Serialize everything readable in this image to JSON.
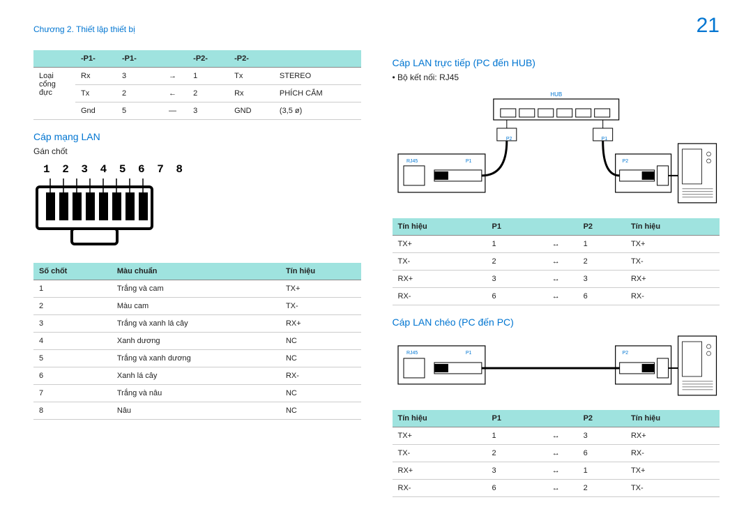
{
  "header": {
    "chapter": "Chương 2. Thiết lập thiết bị",
    "pagenum": "21"
  },
  "pinTable": {
    "headers": [
      "-P1-",
      "-P1-",
      "",
      "-P2-",
      "-P2-",
      ""
    ],
    "rowLabel": "Loại cổng đực",
    "rows": [
      [
        "Rx",
        "3",
        "→",
        "1",
        "Tx",
        "STEREO"
      ],
      [
        "Tx",
        "2",
        "←",
        "2",
        "Rx",
        "PHÍCH CẮM"
      ],
      [
        "Gnd",
        "5",
        "—",
        "3",
        "GND",
        "(3,5 ø)"
      ]
    ]
  },
  "lan": {
    "title": "Cáp mạng LAN",
    "sub": "Gán chốt",
    "pinNumbers": "1 2 3 4 5 6 7 8"
  },
  "colorTable": {
    "headers": [
      "Số chốt",
      "Màu chuẩn",
      "Tín hiệu"
    ],
    "rows": [
      [
        "1",
        "Trắng và cam",
        "TX+"
      ],
      [
        "2",
        "Màu cam",
        "TX-"
      ],
      [
        "3",
        "Trắng và xanh lá cây",
        "RX+"
      ],
      [
        "4",
        "Xanh dương",
        "NC"
      ],
      [
        "5",
        "Trắng và xanh dương",
        "NC"
      ],
      [
        "6",
        "Xanh lá cây",
        "RX-"
      ],
      [
        "7",
        "Trắng và nâu",
        "NC"
      ],
      [
        "8",
        "Nâu",
        "NC"
      ]
    ]
  },
  "directLan": {
    "title": "Cáp LAN trực tiếp (PC đến HUB)",
    "bullet": "Bộ kết nối: RJ45",
    "diagram": {
      "hub": "HUB",
      "p1": "P1",
      "p2": "P2",
      "rj45": "RJ45"
    },
    "headers": [
      "Tín hiệu",
      "P1",
      "",
      "P2",
      "Tín hiệu"
    ],
    "rows": [
      [
        "TX+",
        "1",
        "↔",
        "1",
        "TX+"
      ],
      [
        "TX-",
        "2",
        "↔",
        "2",
        "TX-"
      ],
      [
        "RX+",
        "3",
        "↔",
        "3",
        "RX+"
      ],
      [
        "RX-",
        "6",
        "↔",
        "6",
        "RX-"
      ]
    ]
  },
  "crossLan": {
    "title": "Cáp LAN chéo (PC đến PC)",
    "diagram": {
      "p1": "P1",
      "p2": "P2",
      "rj45": "RJ45"
    },
    "headers": [
      "Tín hiệu",
      "P1",
      "",
      "P2",
      "Tín hiệu"
    ],
    "rows": [
      [
        "TX+",
        "1",
        "↔",
        "3",
        "RX+"
      ],
      [
        "TX-",
        "2",
        "↔",
        "6",
        "RX-"
      ],
      [
        "RX+",
        "3",
        "↔",
        "1",
        "TX+"
      ],
      [
        "RX-",
        "6",
        "↔",
        "2",
        "TX-"
      ]
    ]
  }
}
